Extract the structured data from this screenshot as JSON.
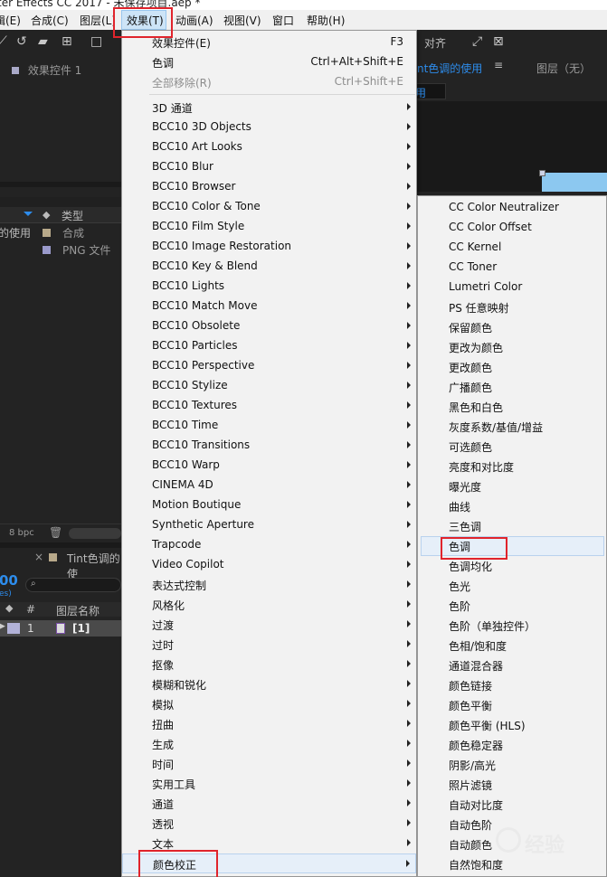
{
  "title_bar": "ter Effects CC 2017 - 未保存项目.aep *",
  "menubar": {
    "items": [
      {
        "label": "辑(E)",
        "key": "edit"
      },
      {
        "label": "合成(C)",
        "key": "composition"
      },
      {
        "label": "图层(L)",
        "key": "layer"
      },
      {
        "label": "效果(T)",
        "key": "effects"
      },
      {
        "label": "动画(A)",
        "key": "animation"
      },
      {
        "label": "视图(V)",
        "key": "view"
      },
      {
        "label": "窗口",
        "key": "window"
      },
      {
        "label": "帮助(H)",
        "key": "help"
      }
    ]
  },
  "toolbar": {
    "align_label": "对齐"
  },
  "left_panel": {
    "effects_control_tab": "效果控件 1",
    "project_columns": {
      "type": "类型"
    },
    "project_items": [
      {
        "name": "的使用",
        "type": "合成"
      },
      {
        "name": "",
        "type": "PNG 文件"
      }
    ],
    "bpc": "8 bpc",
    "timeline_tab": "Tint色调的使",
    "timecode": "00",
    "timecode_sub": "es)",
    "layer_columns": {
      "num": "#",
      "name": "图层名称"
    },
    "layer_row": {
      "num": "1",
      "name": "[1]"
    }
  },
  "right_panel": {
    "comp_tab": "nt色调的使用",
    "layer_tab": "图层（无）",
    "comp_sub": "用"
  },
  "effects_menu": {
    "items": [
      {
        "label": "效果控件(E)",
        "shortcut": "F3"
      },
      {
        "label": "色调",
        "shortcut": "Ctrl+Alt+Shift+E"
      },
      {
        "label": "全部移除(R)",
        "shortcut": "Ctrl+Shift+E",
        "disabled": true
      },
      {
        "label": "3D 通道",
        "submenu": true
      },
      {
        "label": "BCC10 3D Objects",
        "submenu": true
      },
      {
        "label": "BCC10 Art Looks",
        "submenu": true
      },
      {
        "label": "BCC10 Blur",
        "submenu": true
      },
      {
        "label": "BCC10 Browser",
        "submenu": true
      },
      {
        "label": "BCC10 Color & Tone",
        "submenu": true
      },
      {
        "label": "BCC10 Film Style",
        "submenu": true
      },
      {
        "label": "BCC10 Image Restoration",
        "submenu": true
      },
      {
        "label": "BCC10 Key & Blend",
        "submenu": true
      },
      {
        "label": "BCC10 Lights",
        "submenu": true
      },
      {
        "label": "BCC10 Match Move",
        "submenu": true
      },
      {
        "label": "BCC10 Obsolete",
        "submenu": true
      },
      {
        "label": "BCC10 Particles",
        "submenu": true
      },
      {
        "label": "BCC10 Perspective",
        "submenu": true
      },
      {
        "label": "BCC10 Stylize",
        "submenu": true
      },
      {
        "label": "BCC10 Textures",
        "submenu": true
      },
      {
        "label": "BCC10 Time",
        "submenu": true
      },
      {
        "label": "BCC10 Transitions",
        "submenu": true
      },
      {
        "label": "BCC10 Warp",
        "submenu": true
      },
      {
        "label": "CINEMA 4D",
        "submenu": true
      },
      {
        "label": "Motion Boutique",
        "submenu": true
      },
      {
        "label": "Synthetic Aperture",
        "submenu": true
      },
      {
        "label": "Trapcode",
        "submenu": true
      },
      {
        "label": "Video Copilot",
        "submenu": true
      },
      {
        "label": "表达式控制",
        "submenu": true
      },
      {
        "label": "风格化",
        "submenu": true
      },
      {
        "label": "过渡",
        "submenu": true
      },
      {
        "label": "过时",
        "submenu": true
      },
      {
        "label": "抠像",
        "submenu": true
      },
      {
        "label": "模糊和锐化",
        "submenu": true
      },
      {
        "label": "模拟",
        "submenu": true
      },
      {
        "label": "扭曲",
        "submenu": true
      },
      {
        "label": "生成",
        "submenu": true
      },
      {
        "label": "时间",
        "submenu": true
      },
      {
        "label": "实用工具",
        "submenu": true
      },
      {
        "label": "通道",
        "submenu": true
      },
      {
        "label": "透视",
        "submenu": true
      },
      {
        "label": "文本",
        "submenu": true
      },
      {
        "label": "颜色校正",
        "submenu": true,
        "highlighted": true
      }
    ]
  },
  "color_correction_submenu": {
    "items": [
      {
        "label": "CC Color Neutralizer"
      },
      {
        "label": "CC Color Offset"
      },
      {
        "label": "CC Kernel"
      },
      {
        "label": "CC Toner"
      },
      {
        "label": "Lumetri Color"
      },
      {
        "label": "PS 任意映射"
      },
      {
        "label": "保留颜色"
      },
      {
        "label": "更改为颜色"
      },
      {
        "label": "更改颜色"
      },
      {
        "label": "广播颜色"
      },
      {
        "label": "黑色和白色"
      },
      {
        "label": "灰度系数/基值/增益"
      },
      {
        "label": "可选颜色"
      },
      {
        "label": "亮度和对比度"
      },
      {
        "label": "曝光度"
      },
      {
        "label": "曲线"
      },
      {
        "label": "三色调"
      },
      {
        "label": "色调",
        "highlighted": true
      },
      {
        "label": "色调均化"
      },
      {
        "label": "色光"
      },
      {
        "label": "色阶"
      },
      {
        "label": "色阶（单独控件）"
      },
      {
        "label": "色相/饱和度"
      },
      {
        "label": "通道混合器"
      },
      {
        "label": "颜色链接"
      },
      {
        "label": "颜色平衡"
      },
      {
        "label": "颜色平衡 (HLS)"
      },
      {
        "label": "颜色稳定器"
      },
      {
        "label": "阴影/高光"
      },
      {
        "label": "照片滤镜"
      },
      {
        "label": "自动对比度"
      },
      {
        "label": "自动色阶"
      },
      {
        "label": "自动颜色"
      },
      {
        "label": "自然饱和度"
      }
    ]
  },
  "watermark": "经验",
  "colors": {
    "highlight_box": "#e0242c",
    "accent_blue": "#2d8ceb"
  }
}
